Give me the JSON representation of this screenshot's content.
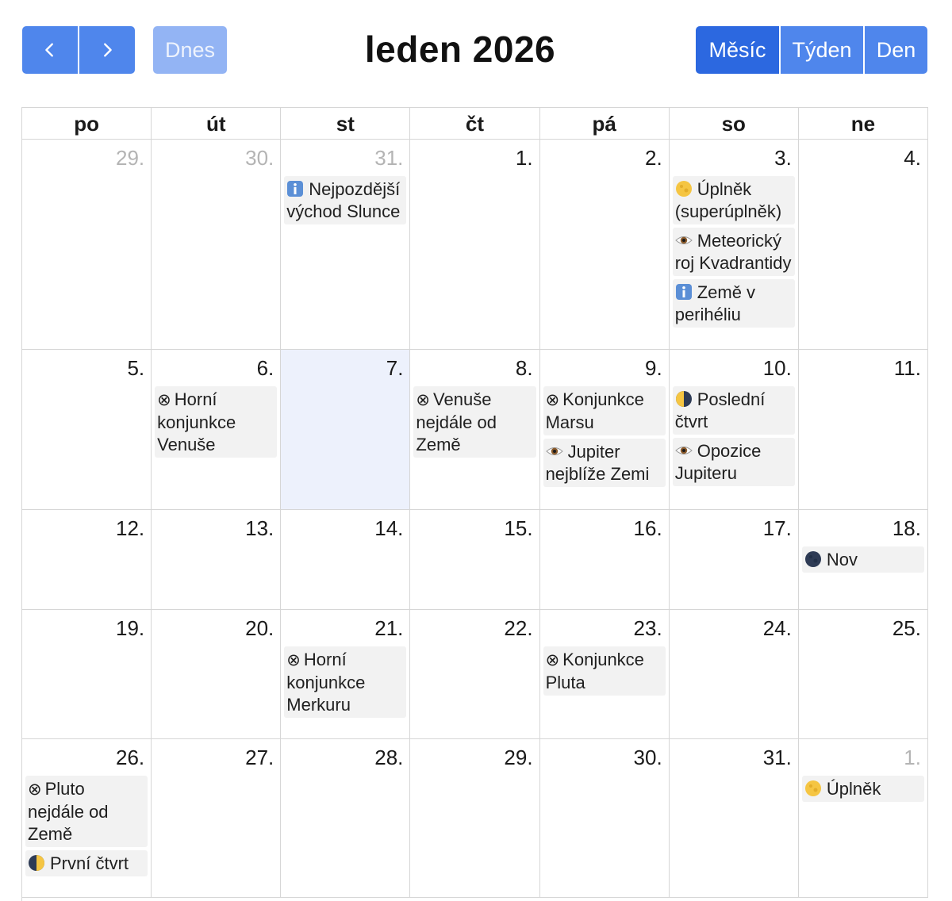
{
  "toolbar": {
    "prev_icon": "chevron-left-icon",
    "next_icon": "chevron-right-icon",
    "today_label": "Dnes",
    "title": "leden 2026",
    "views": [
      "Měsíc",
      "Týden",
      "Den"
    ],
    "active_view": "Měsíc"
  },
  "colors": {
    "button": "#4f86ec",
    "button_active": "#2c68e0",
    "button_disabled": "#93b4f4",
    "today_bg": "#edf1fc",
    "event_bg": "#f2f2f2"
  },
  "weekdays": [
    "po",
    "út",
    "st",
    "čt",
    "pá",
    "so",
    "ne"
  ],
  "weeks": [
    [
      {
        "num": "29.",
        "other": true,
        "events": []
      },
      {
        "num": "30.",
        "other": true,
        "events": []
      },
      {
        "num": "31.",
        "other": true,
        "events": [
          {
            "icon": "info-icon",
            "text": "Nejpozdější východ Slunce"
          }
        ]
      },
      {
        "num": "1.",
        "events": []
      },
      {
        "num": "2.",
        "events": []
      },
      {
        "num": "3.",
        "events": [
          {
            "icon": "full-moon-icon",
            "text": "Úplněk (superúplněk)"
          },
          {
            "icon": "eye-icon",
            "text": "Meteorický roj Kvadrantidy"
          },
          {
            "icon": "info-icon",
            "text": "Země v perihéliu"
          }
        ]
      },
      {
        "num": "4.",
        "events": []
      }
    ],
    [
      {
        "num": "5.",
        "events": []
      },
      {
        "num": "6.",
        "events": [
          {
            "icon": "conjunction-icon",
            "text": "Horní konjunkce Venuše"
          }
        ]
      },
      {
        "num": "7.",
        "today": true,
        "events": []
      },
      {
        "num": "8.",
        "events": [
          {
            "icon": "conjunction-icon",
            "text": "Venuše nejdále od Země"
          }
        ]
      },
      {
        "num": "9.",
        "events": [
          {
            "icon": "conjunction-icon",
            "text": "Konjunkce Marsu"
          },
          {
            "icon": "eye-icon",
            "text": "Jupiter nejblíže Zemi"
          }
        ]
      },
      {
        "num": "10.",
        "events": [
          {
            "icon": "last-quarter-moon-icon",
            "text": "Poslední čtvrt"
          },
          {
            "icon": "eye-icon",
            "text": "Opozice Jupiteru"
          }
        ]
      },
      {
        "num": "11.",
        "events": []
      }
    ],
    [
      {
        "num": "12.",
        "events": []
      },
      {
        "num": "13.",
        "events": []
      },
      {
        "num": "14.",
        "events": []
      },
      {
        "num": "15.",
        "events": []
      },
      {
        "num": "16.",
        "events": []
      },
      {
        "num": "17.",
        "events": []
      },
      {
        "num": "18.",
        "events": [
          {
            "icon": "new-moon-icon",
            "text": "Nov"
          }
        ]
      }
    ],
    [
      {
        "num": "19.",
        "events": []
      },
      {
        "num": "20.",
        "events": []
      },
      {
        "num": "21.",
        "events": [
          {
            "icon": "conjunction-icon",
            "text": "Horní konjunkce Merkuru"
          }
        ]
      },
      {
        "num": "22.",
        "events": []
      },
      {
        "num": "23.",
        "events": [
          {
            "icon": "conjunction-icon",
            "text": "Konjunkce Pluta"
          }
        ]
      },
      {
        "num": "24.",
        "events": []
      },
      {
        "num": "25.",
        "events": []
      }
    ],
    [
      {
        "num": "26.",
        "events": [
          {
            "icon": "conjunction-icon",
            "text": "Pluto nejdále od Země"
          },
          {
            "icon": "first-quarter-moon-icon",
            "text": "První čtvrt"
          }
        ]
      },
      {
        "num": "27.",
        "events": []
      },
      {
        "num": "28.",
        "events": []
      },
      {
        "num": "29.",
        "events": []
      },
      {
        "num": "30.",
        "events": []
      },
      {
        "num": "31.",
        "events": []
      },
      {
        "num": "1.",
        "other": true,
        "events": [
          {
            "icon": "full-moon-icon",
            "text": "Úplněk"
          }
        ]
      }
    ]
  ]
}
